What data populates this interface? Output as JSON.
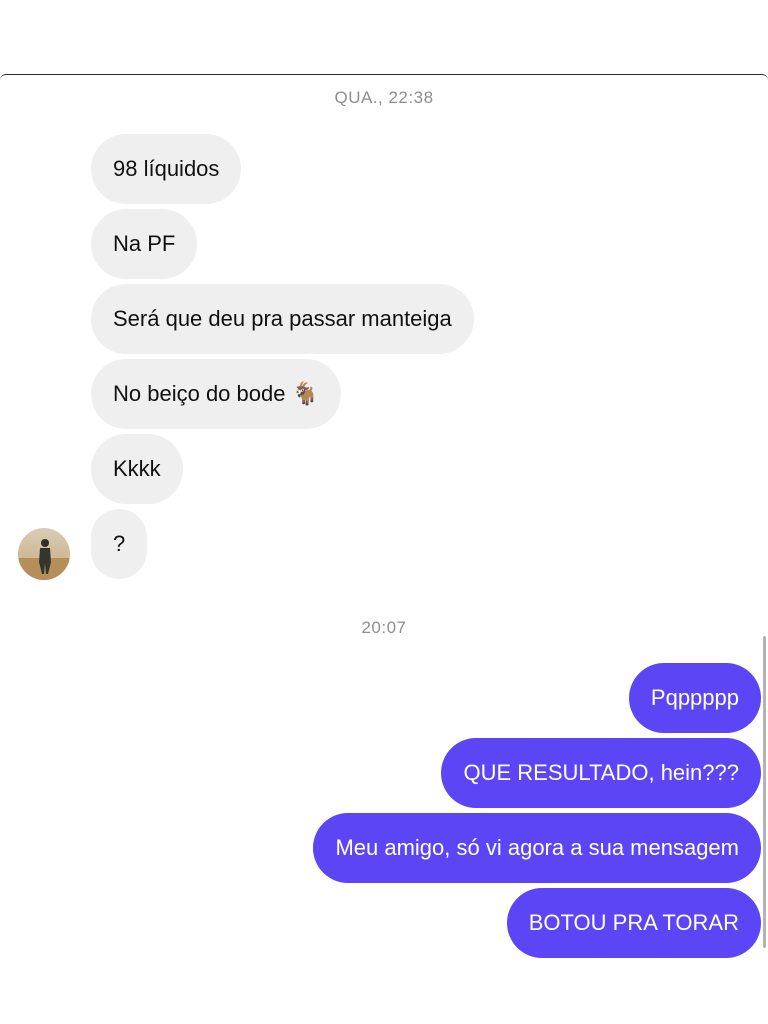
{
  "timestamps": {
    "first": "QUA., 22:38",
    "second": "20:07"
  },
  "incoming": [
    {
      "text": "98 líquidos"
    },
    {
      "text": "Na PF"
    },
    {
      "text": "Será que deu pra passar manteiga"
    },
    {
      "text": "No beiço do bode 🐐"
    },
    {
      "text": "Kkkk"
    },
    {
      "text": "?"
    }
  ],
  "outgoing": [
    {
      "text": "Pqppppp"
    },
    {
      "text": "QUE RESULTADO, hein???"
    },
    {
      "text": "Meu amigo, só vi agora a sua mensagem"
    },
    {
      "text": "BOTOU PRA TORAR"
    }
  ],
  "colors": {
    "incoming_bubble": "#efeff0",
    "outgoing_bubble": "#5b45f5",
    "timestamp": "#8e8e8e"
  },
  "icons": {
    "avatar": "contact-avatar-photo"
  }
}
